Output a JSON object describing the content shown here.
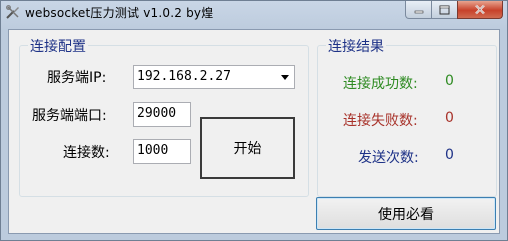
{
  "window": {
    "title": "websocket压力测试 v1.0.2 by煌",
    "app_icon": "tools-icon",
    "minimize_icon": "minimize-icon",
    "maximize_icon": "maximize-icon",
    "close_icon": "close-icon"
  },
  "config": {
    "group_title": "连接配置",
    "server_ip_label": "服务端IP:",
    "server_ip_value": "192.168.2.27",
    "server_port_label": "服务端端口:",
    "server_port_value": "29000",
    "connections_label": "连接数:",
    "connections_value": "1000",
    "start_button": "开始"
  },
  "results": {
    "group_title": "连接结果",
    "items": [
      {
        "label": "连接成功数:",
        "value": "0",
        "color": "#2e8b22"
      },
      {
        "label": "连接失败数:",
        "value": "0",
        "color": "#a8322a"
      },
      {
        "label": "发送次数:",
        "value": "0",
        "color": "#1e3287"
      }
    ]
  },
  "help_button": "使用必看",
  "colors": {
    "group_title": "#1e3287",
    "accent_border": "#3c7fb1"
  }
}
